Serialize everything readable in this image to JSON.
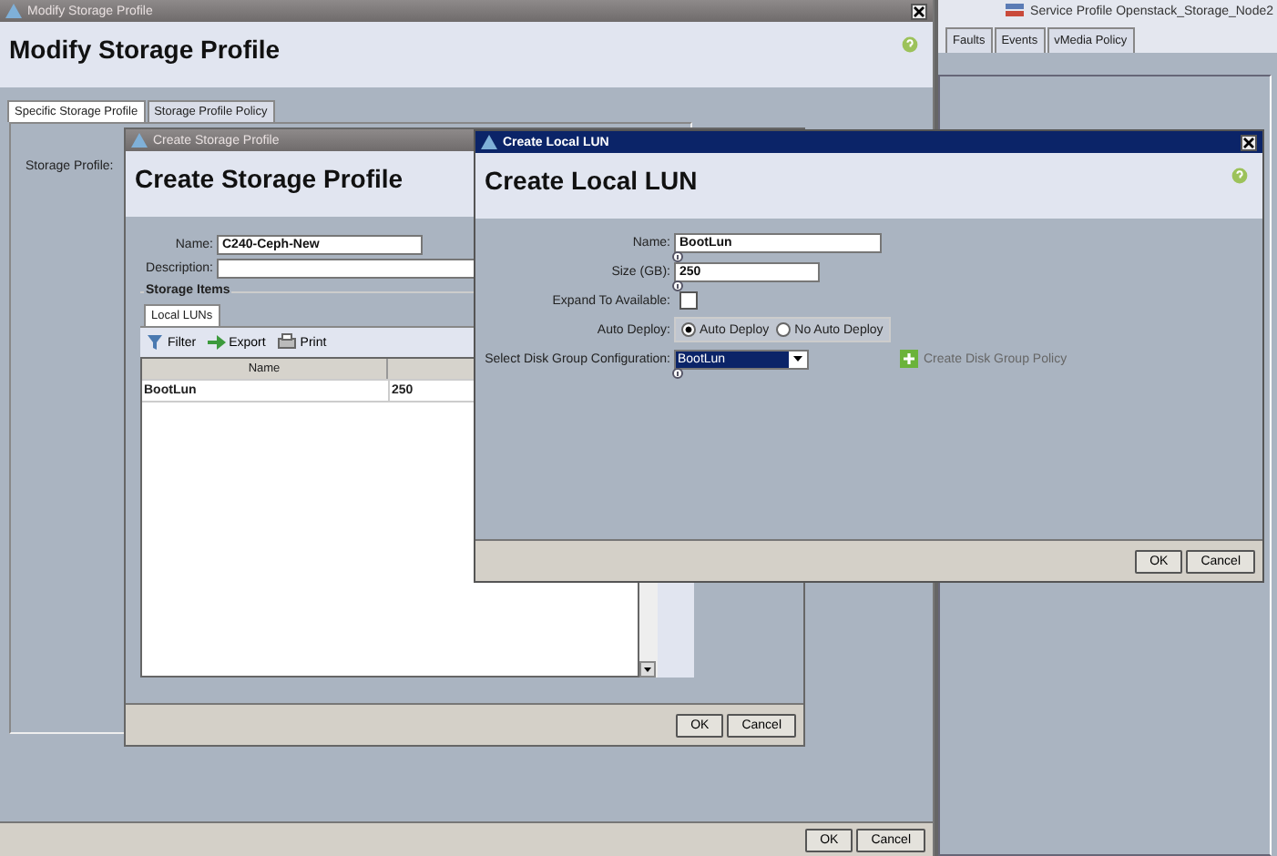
{
  "background_window": {
    "title": "Service Profile Openstack_Storage_Node2",
    "tabs": [
      {
        "label": "Faults",
        "selected": false
      },
      {
        "label": "Events",
        "selected": false
      },
      {
        "label": "vMedia Policy",
        "selected": false
      }
    ]
  },
  "modify_window": {
    "title": "Modify Storage Profile",
    "heading": "Modify Storage Profile",
    "tabs": [
      {
        "label": "Specific Storage Profile",
        "selected": true
      },
      {
        "label": "Storage Profile Policy",
        "selected": false
      }
    ],
    "storage_profile_label": "Storage Profile:",
    "buttons": [
      "OK",
      "Cancel"
    ]
  },
  "create_profile_window": {
    "title": "Create Storage Profile",
    "heading": "Create Storage Profile",
    "fields": [
      {
        "label": "Name:",
        "value": "C240-Ceph-New"
      },
      {
        "label": "Description:"
      }
    ],
    "storage_items": {
      "legend": "Storage Items",
      "tabs": [
        {
          "label": "Local LUNs",
          "selected": true
        }
      ],
      "toolbar": [
        {
          "kind": "filter",
          "label": "Filter"
        },
        {
          "kind": "export",
          "label": "Export"
        },
        {
          "kind": "print",
          "label": "Print"
        }
      ],
      "table": {
        "columns": [
          "Name"
        ],
        "rows": [
          [
            "BootLun",
            "250"
          ]
        ]
      }
    },
    "buttons": [
      "OK",
      "Cancel"
    ]
  },
  "create_lun_window": {
    "title": "Create Local LUN",
    "heading": "Create Local LUN",
    "fields": [
      {
        "kind": "text",
        "label": "Name:",
        "value": "BootLun"
      },
      {
        "kind": "text",
        "label": "Size (GB):",
        "value": "250"
      },
      {
        "kind": "checkbox",
        "label": "Expand To Available:",
        "checked": false
      },
      {
        "kind": "radio",
        "label": "Auto Deploy:",
        "options": [
          {
            "label": "Auto Deploy",
            "selected": true
          },
          {
            "label": "No Auto Deploy",
            "selected": false
          }
        ]
      },
      {
        "kind": "select",
        "label": "Select Disk Group Configuration:",
        "value": "BootLun",
        "link": "Create Disk Group Policy"
      }
    ],
    "buttons": [
      "OK",
      "Cancel"
    ]
  }
}
